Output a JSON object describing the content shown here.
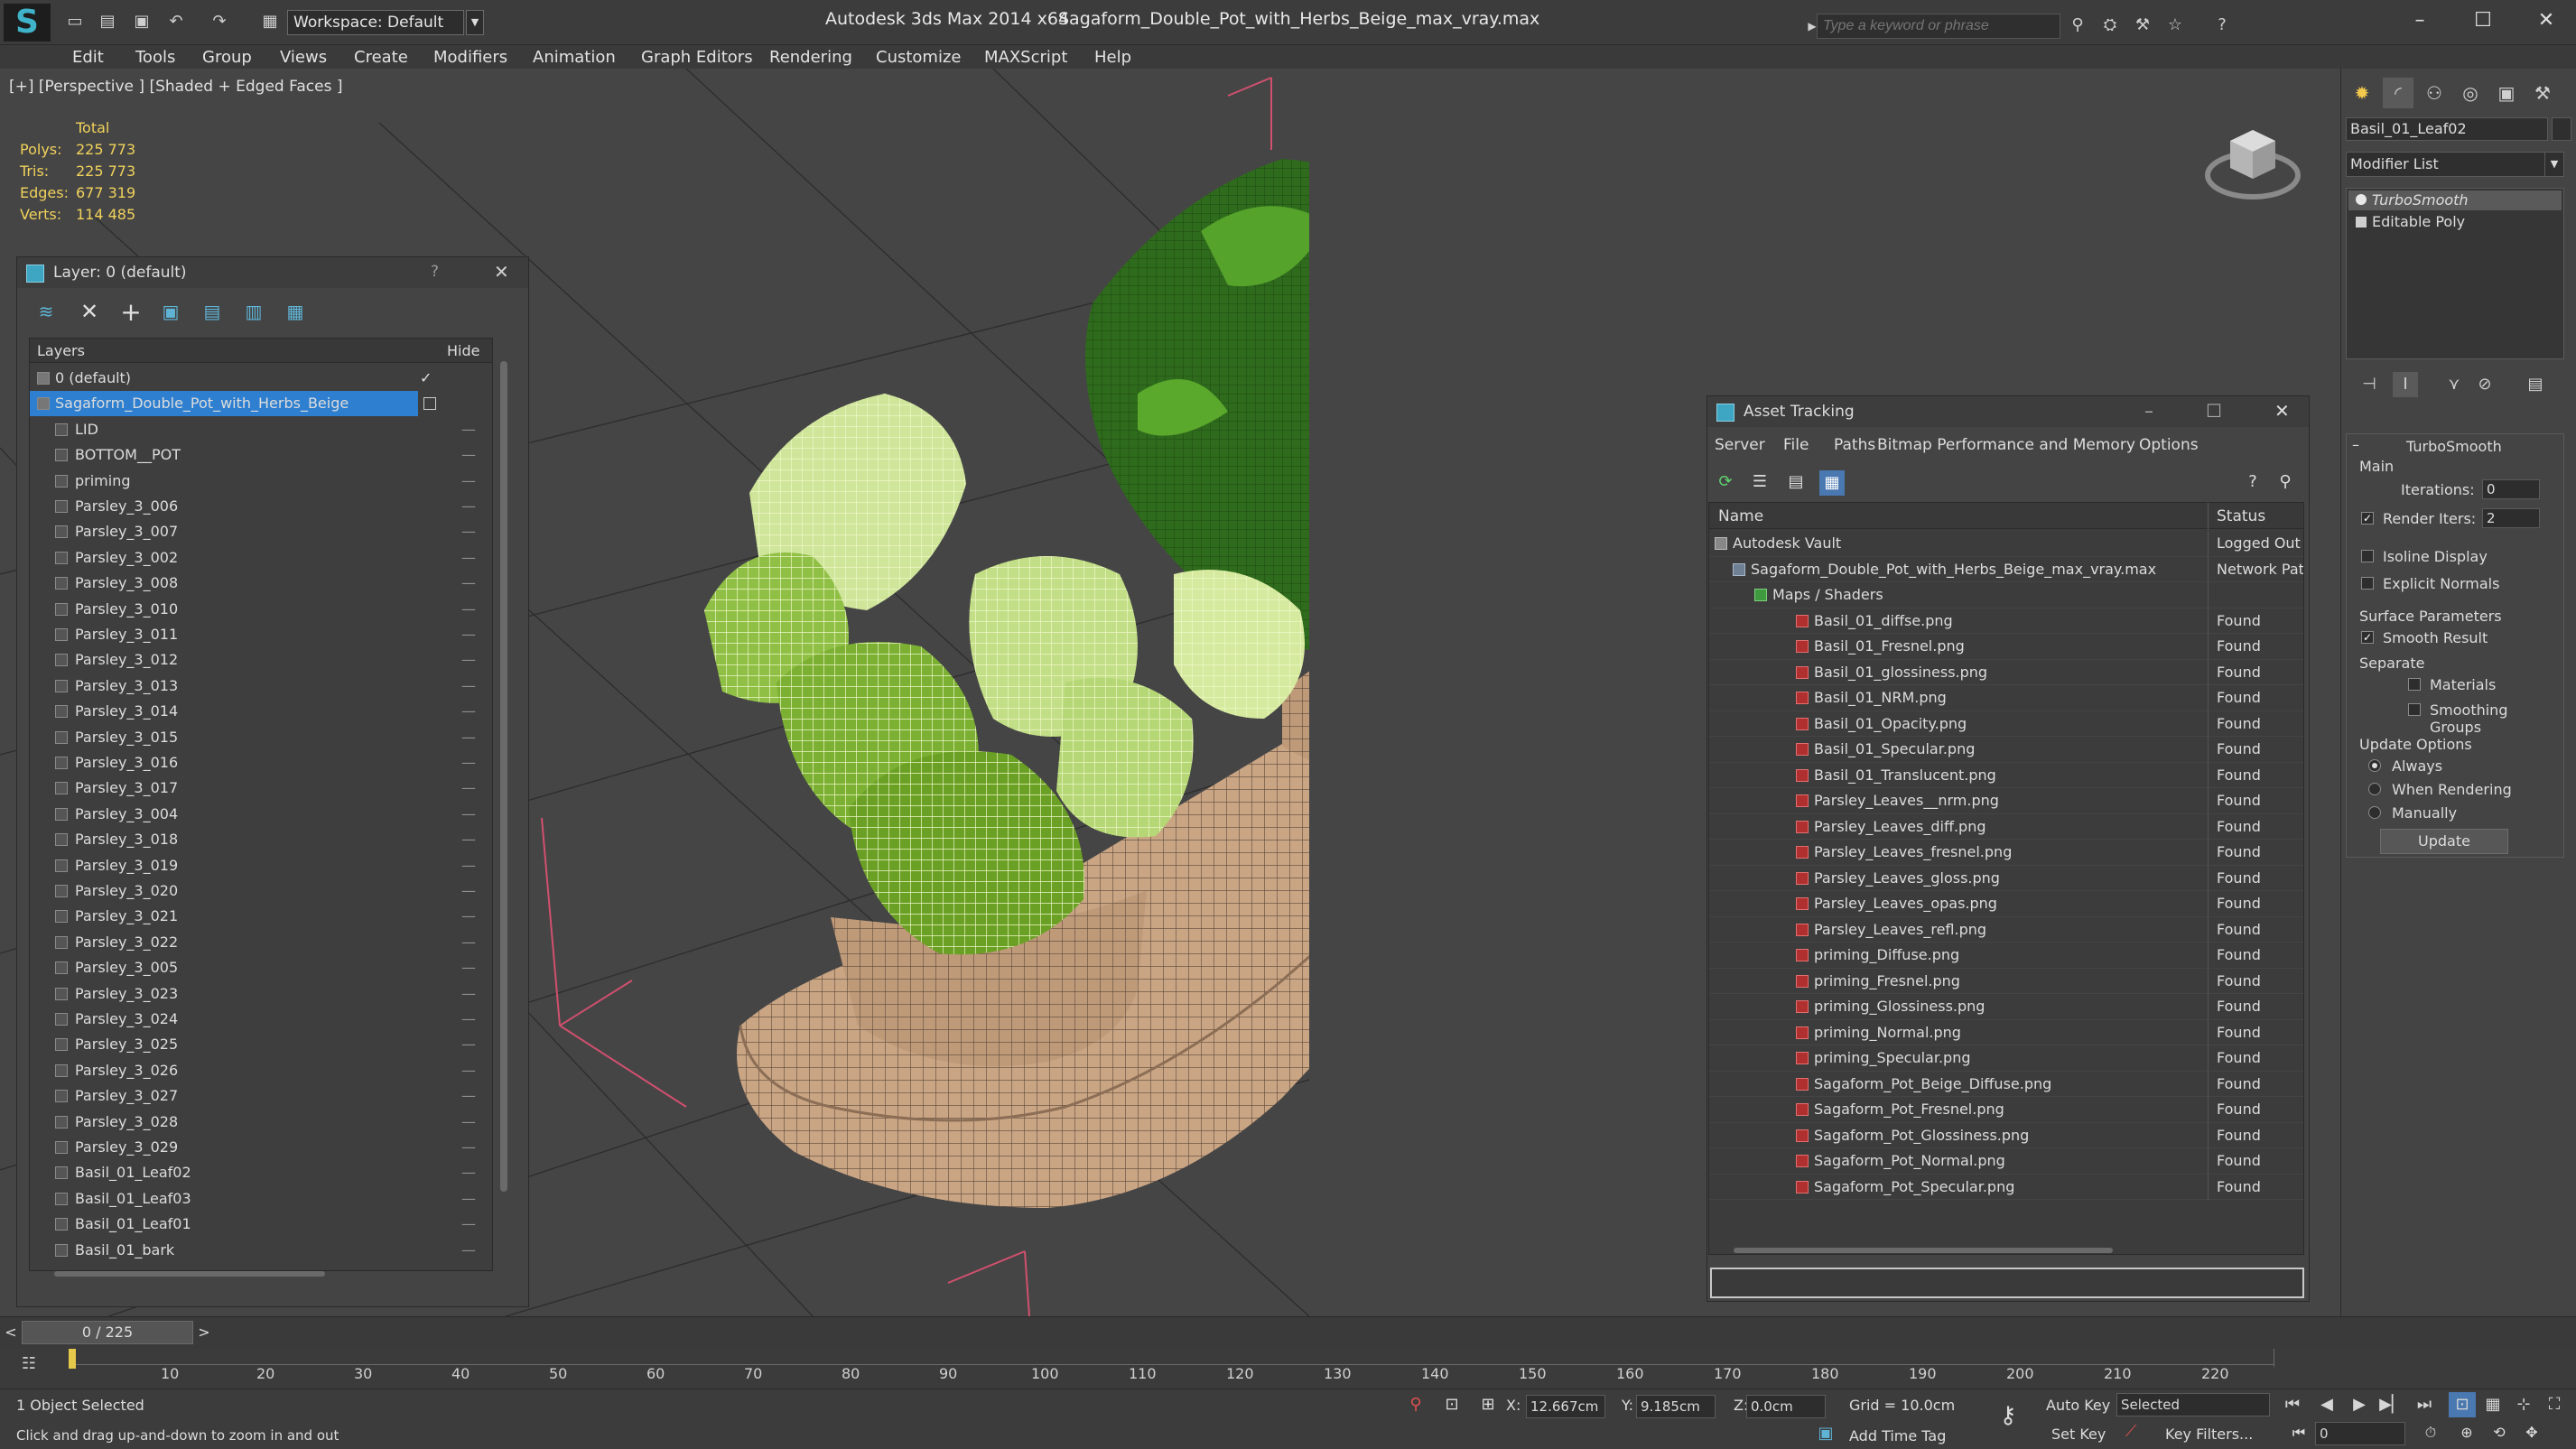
{
  "app": {
    "logo": "S",
    "workspace": "Workspace: Default",
    "title_app": "Autodesk 3ds Max  2014 x64",
    "title_file": "Sagaform_Double_Pot_with_Herbs_Beige_max_vray.max",
    "search_placeholder": "Type a keyword or phrase"
  },
  "menu": [
    "Edit",
    "Tools",
    "Group",
    "Views",
    "Create",
    "Modifiers",
    "Animation",
    "Graph Editors",
    "Rendering",
    "Customize",
    "MAXScript",
    "Help"
  ],
  "viewport": {
    "label": "[+] [Perspective ] [Shaded + Edged Faces ]",
    "stats_header": "Total",
    "stats": [
      {
        "label": "Polys:",
        "value": "225 773"
      },
      {
        "label": "Tris:",
        "value": "225 773"
      },
      {
        "label": "Edges:",
        "value": "677 319"
      },
      {
        "label": "Verts:",
        "value": "114 485"
      }
    ]
  },
  "layer_dialog": {
    "title": "Layer: 0 (default)",
    "help": "?",
    "close": "✕",
    "col_layers": "Layers",
    "col_hide": "Hide",
    "rows": [
      {
        "name": "0 (default)",
        "hide": "✓"
      },
      {
        "name": "Sagaform_Double_Pot_with_Herbs_Beige",
        "hide": ""
      },
      {
        "name": "LID",
        "hide": "—"
      },
      {
        "name": "BOTTOM__POT",
        "hide": "—"
      },
      {
        "name": "priming",
        "hide": "—"
      },
      {
        "name": "Parsley_3_006",
        "hide": "—"
      },
      {
        "name": "Parsley_3_007",
        "hide": "—"
      },
      {
        "name": "Parsley_3_002",
        "hide": "—"
      },
      {
        "name": "Parsley_3_008",
        "hide": "—"
      },
      {
        "name": "Parsley_3_010",
        "hide": "—"
      },
      {
        "name": "Parsley_3_011",
        "hide": "—"
      },
      {
        "name": "Parsley_3_012",
        "hide": "—"
      },
      {
        "name": "Parsley_3_013",
        "hide": "—"
      },
      {
        "name": "Parsley_3_014",
        "hide": "—"
      },
      {
        "name": "Parsley_3_015",
        "hide": "—"
      },
      {
        "name": "Parsley_3_016",
        "hide": "—"
      },
      {
        "name": "Parsley_3_017",
        "hide": "—"
      },
      {
        "name": "Parsley_3_004",
        "hide": "—"
      },
      {
        "name": "Parsley_3_018",
        "hide": "—"
      },
      {
        "name": "Parsley_3_019",
        "hide": "—"
      },
      {
        "name": "Parsley_3_020",
        "hide": "—"
      },
      {
        "name": "Parsley_3_021",
        "hide": "—"
      },
      {
        "name": "Parsley_3_022",
        "hide": "—"
      },
      {
        "name": "Parsley_3_005",
        "hide": "—"
      },
      {
        "name": "Parsley_3_023",
        "hide": "—"
      },
      {
        "name": "Parsley_3_024",
        "hide": "—"
      },
      {
        "name": "Parsley_3_025",
        "hide": "—"
      },
      {
        "name": "Parsley_3_026",
        "hide": "—"
      },
      {
        "name": "Parsley_3_027",
        "hide": "—"
      },
      {
        "name": "Parsley_3_028",
        "hide": "—"
      },
      {
        "name": "Parsley_3_029",
        "hide": "—"
      },
      {
        "name": "Basil_01_Leaf02",
        "hide": "—"
      },
      {
        "name": "Basil_01_Leaf03",
        "hide": "—"
      },
      {
        "name": "Basil_01_Leaf01",
        "hide": "—"
      },
      {
        "name": "Basil_01_bark",
        "hide": "—"
      }
    ]
  },
  "asset_dialog": {
    "title": "Asset Tracking",
    "menu": [
      "Server",
      "File",
      "Paths",
      "Bitmap Performance and Memory",
      "Options"
    ],
    "col_name": "Name",
    "col_status": "Status",
    "rows": [
      {
        "name": "Autodesk Vault",
        "status": "Logged Out",
        "level": 1,
        "kind": "vault"
      },
      {
        "name": "Sagaform_Double_Pot_with_Herbs_Beige_max_vray.max",
        "status": "Network Pat",
        "level": 2,
        "kind": "file"
      },
      {
        "name": "Maps / Shaders",
        "status": "",
        "level": 3,
        "kind": "folder"
      },
      {
        "name": "Basil_01_diffse.png",
        "status": "Found",
        "level": 4,
        "kind": "png"
      },
      {
        "name": "Basil_01_Fresnel.png",
        "status": "Found",
        "level": 4,
        "kind": "png"
      },
      {
        "name": "Basil_01_glossiness.png",
        "status": "Found",
        "level": 4,
        "kind": "png"
      },
      {
        "name": "Basil_01_NRM.png",
        "status": "Found",
        "level": 4,
        "kind": "png"
      },
      {
        "name": "Basil_01_Opacity.png",
        "status": "Found",
        "level": 4,
        "kind": "png"
      },
      {
        "name": "Basil_01_Specular.png",
        "status": "Found",
        "level": 4,
        "kind": "png"
      },
      {
        "name": "Basil_01_Translucent.png",
        "status": "Found",
        "level": 4,
        "kind": "png"
      },
      {
        "name": "Parsley_Leaves__nrm.png",
        "status": "Found",
        "level": 4,
        "kind": "png"
      },
      {
        "name": "Parsley_Leaves_diff.png",
        "status": "Found",
        "level": 4,
        "kind": "png"
      },
      {
        "name": "Parsley_Leaves_fresnel.png",
        "status": "Found",
        "level": 4,
        "kind": "png"
      },
      {
        "name": "Parsley_Leaves_gloss.png",
        "status": "Found",
        "level": 4,
        "kind": "png"
      },
      {
        "name": "Parsley_Leaves_opas.png",
        "status": "Found",
        "level": 4,
        "kind": "png"
      },
      {
        "name": "Parsley_Leaves_refl.png",
        "status": "Found",
        "level": 4,
        "kind": "png"
      },
      {
        "name": "priming_Diffuse.png",
        "status": "Found",
        "level": 4,
        "kind": "png"
      },
      {
        "name": "priming_Fresnel.png",
        "status": "Found",
        "level": 4,
        "kind": "png"
      },
      {
        "name": "priming_Glossiness.png",
        "status": "Found",
        "level": 4,
        "kind": "png"
      },
      {
        "name": "priming_Normal.png",
        "status": "Found",
        "level": 4,
        "kind": "png"
      },
      {
        "name": "priming_Specular.png",
        "status": "Found",
        "level": 4,
        "kind": "png"
      },
      {
        "name": "Sagaform_Pot_Beige_Diffuse.png",
        "status": "Found",
        "level": 4,
        "kind": "png"
      },
      {
        "name": "Sagaform_Pot_Fresnel.png",
        "status": "Found",
        "level": 4,
        "kind": "png"
      },
      {
        "name": "Sagaform_Pot_Glossiness.png",
        "status": "Found",
        "level": 4,
        "kind": "png"
      },
      {
        "name": "Sagaform_Pot_Normal.png",
        "status": "Found",
        "level": 4,
        "kind": "png"
      },
      {
        "name": "Sagaform_Pot_Specular.png",
        "status": "Found",
        "level": 4,
        "kind": "png"
      }
    ]
  },
  "command_panel": {
    "object_name": "Basil_01_Leaf02",
    "modifier_list": "Modifier List",
    "stack": [
      "TurboSmooth",
      "Editable Poly"
    ],
    "turbosmooth": {
      "title": "TurboSmooth",
      "main": "Main",
      "iterations_label": "Iterations:",
      "iterations": "0",
      "render_iters_label": "Render Iters:",
      "render_iters": "2",
      "isoline": "Isoline Display",
      "explicit_normals": "Explicit Normals",
      "surface_params": "Surface Parameters",
      "smooth_result": "Smooth Result",
      "separate": "Separate",
      "materials": "Materials",
      "smoothing_groups": "Smoothing Groups",
      "update_options": "Update Options",
      "always": "Always",
      "when_rendering": "When Rendering",
      "manually": "Manually",
      "update": "Update"
    }
  },
  "timeline": {
    "frame": "0 / 225",
    "prev": "<",
    "next": ">",
    "ticks": [
      "10",
      "20",
      "30",
      "40",
      "50",
      "60",
      "70",
      "80",
      "90",
      "100",
      "110",
      "120",
      "130",
      "140",
      "150",
      "160",
      "170",
      "180",
      "190",
      "200",
      "210",
      "220"
    ]
  },
  "status": {
    "selected": "1 Object Selected",
    "hint": "Click and drag up-and-down to zoom in and out",
    "x_label": "X:",
    "x": "12.667cm",
    "y_label": "Y:",
    "y": "9.185cm",
    "z_label": "Z:",
    "z": "0.0cm",
    "grid": "Grid = 10.0cm",
    "add_time_tag": "Add Time Tag",
    "auto_key": "Auto Key",
    "set_key": "Set Key",
    "selected_dropdown": "Selected",
    "key_filters": "Key Filters...",
    "frame_field": "0"
  }
}
